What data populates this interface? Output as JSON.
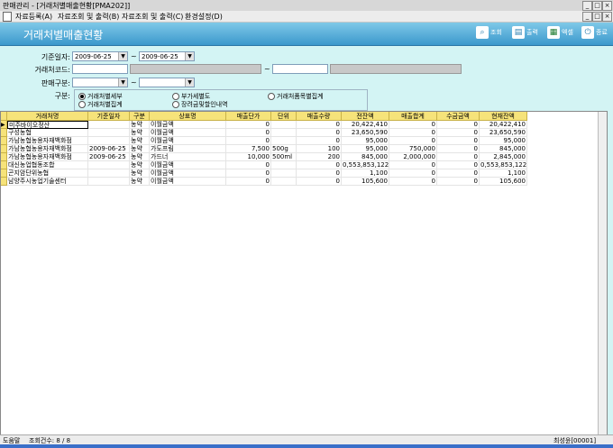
{
  "window": {
    "title": "판매관리 - [거래처별매출현황[PMA202]]"
  },
  "menu": [
    "자료등록(A)",
    "자료조회 및 출력(B)",
    "자료조회 및 출력(C)",
    "환경설정(D)"
  ],
  "header": {
    "title": "거래처별매출현황",
    "buttons": [
      {
        "label": "조회",
        "icon": "search-icon"
      },
      {
        "label": "출력",
        "icon": "printer-icon"
      },
      {
        "label": "엑셀",
        "icon": "excel-icon"
      },
      {
        "label": "종료",
        "icon": "power-icon"
      }
    ]
  },
  "filters": {
    "date_label": "기준일자:",
    "date_from": "2009-06-25",
    "date_to": "2009-06-25",
    "client_label": "거래처코드:",
    "sales_type_label": "판매구분:",
    "category_label": "구분:",
    "tilde": "~"
  },
  "radios": [
    {
      "label": "거래처별세부",
      "checked": true
    },
    {
      "label": "부가세별도",
      "checked": false
    },
    {
      "label": "거래처품목별집계",
      "checked": false
    },
    {
      "label": "거래처별집계",
      "checked": false
    },
    {
      "label": "장려금및할인내역",
      "checked": false
    }
  ],
  "table": {
    "columns": [
      "거래처명",
      "기준일자",
      "구분",
      "상표명",
      "매출단가",
      "단위",
      "매출수량",
      "전잔액",
      "매출합계",
      "수금금액",
      "현재잔액"
    ],
    "rows": [
      [
        "미주바이오정산",
        "",
        "농약",
        "이월금액",
        "0",
        "",
        "0",
        "20,422,410",
        "0",
        "0",
        "20,422,410"
      ],
      [
        "구성농협",
        "",
        "농약",
        "이월금액",
        "0",
        "",
        "0",
        "23,650,590",
        "0",
        "0",
        "23,650,590"
      ],
      [
        "가남농협농용자재백화점",
        "",
        "농약",
        "이월금액",
        "0",
        "",
        "0",
        "95,000",
        "0",
        "0",
        "95,000"
      ],
      [
        "가남농협농용자재백화점",
        "2009-06-25",
        "농약",
        "가도프림",
        "7,500",
        "500g",
        "100",
        "95,000",
        "750,000",
        "0",
        "845,000"
      ],
      [
        "가남농협농용자재백화점",
        "2009-06-25",
        "농약",
        "가드너",
        "10,000",
        "500ml",
        "200",
        "845,000",
        "2,000,000",
        "0",
        "2,845,000"
      ],
      [
        "대신농업협동조합",
        "",
        "농약",
        "이월금액",
        "0",
        "",
        "0",
        "0,553,853,122",
        "0",
        "0",
        "0,553,853,122"
      ],
      [
        "곤지암단위농협",
        "",
        "농약",
        "이월금액",
        "0",
        "",
        "0",
        "1,100",
        "0",
        "0",
        "1,100"
      ],
      [
        "남양주시농업기술센터",
        "",
        "농약",
        "이월금액",
        "0",
        "",
        "0",
        "105,600",
        "0",
        "0",
        "105,600"
      ]
    ]
  },
  "status": {
    "mode": "도움말",
    "count": "조회건수: 8 / 8",
    "user": "최성윤[00001]"
  }
}
